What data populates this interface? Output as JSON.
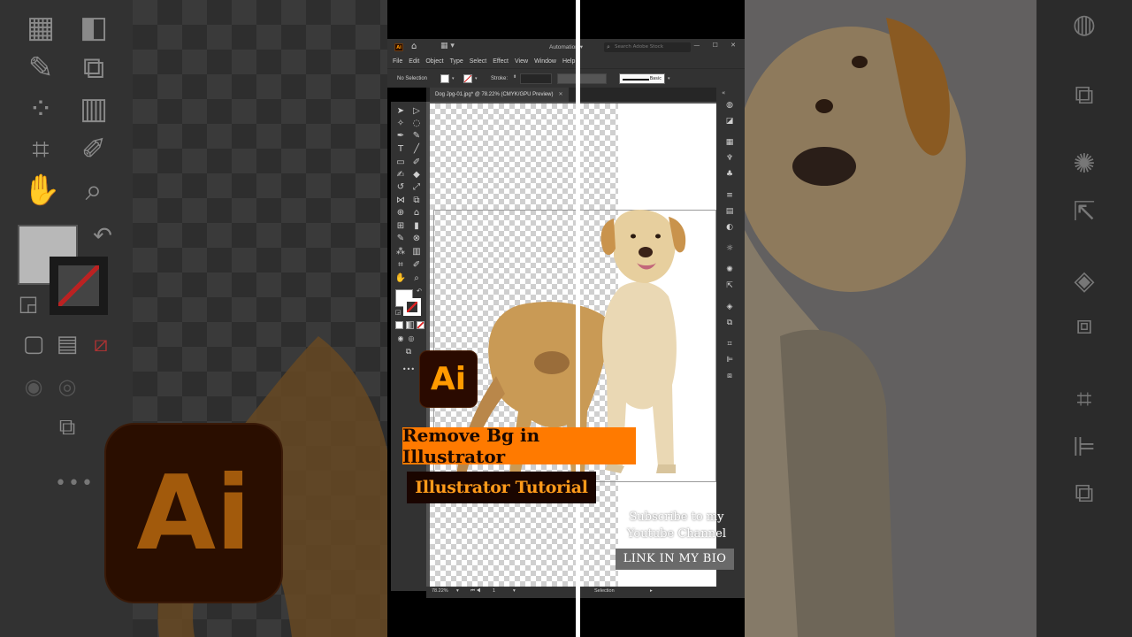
{
  "app": {
    "menu": [
      "File",
      "Edit",
      "Object",
      "Type",
      "Select",
      "Effect",
      "View",
      "Window",
      "Help"
    ],
    "badge": "Ai",
    "workspace": "Automation",
    "search_placeholder": "Search Adobe Stock",
    "window_controls": "— ☐ ✕"
  },
  "control_bar": {
    "selection_label": "No Selection",
    "stroke_label": "Stroke:",
    "brush_label": "Basic"
  },
  "document": {
    "tab_title": "Dog Jpg-01.jpg* @ 78.22% (CMYK/GPU Preview)",
    "close_glyph": "✕"
  },
  "status_bar": {
    "zoom": "78.22%",
    "artboard": "1",
    "tool_status": "Selection"
  },
  "overlay": {
    "logo": "Ai",
    "title_banner": "Remove Bg in Illustrator",
    "subtitle_banner": "Illustrator Tutorial",
    "subscribe_text": "Subscribe to my Youtube Channel",
    "link_text": "LINK IN MY BIO"
  },
  "background": {
    "zoom_logo": "Ai",
    "zoom_dots": "•••"
  },
  "colors": {
    "accent_orange": "#ff7a00",
    "logo_bg": "#2a0a00",
    "ui_dark": "#323232"
  },
  "icons": [
    "selection-tool-icon",
    "direct-selection-icon",
    "magic-wand-icon",
    "lasso-icon",
    "pen-icon",
    "type-icon",
    "rectangle-icon",
    "paintbrush-icon",
    "rotate-icon",
    "scale-icon",
    "eyedropper-icon",
    "hand-icon",
    "zoom-icon",
    "home-icon",
    "search-icon"
  ]
}
